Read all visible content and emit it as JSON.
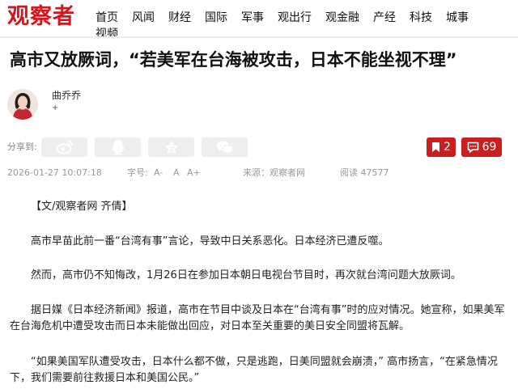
{
  "header": {
    "logo": "观察者",
    "nav": [
      "首页",
      "风闻",
      "财经",
      "国际",
      "军事",
      "观出行",
      "观金融",
      "产经",
      "科技",
      "城事",
      "视频"
    ]
  },
  "article": {
    "title": "高市又放厥词，“若美军在台海被攻击，日本不能坐视不理”",
    "author": {
      "name": "曲乔乔",
      "mark": "+"
    },
    "share": {
      "label": "分享到:"
    },
    "favorites": "2",
    "comments": "69",
    "meta": {
      "datetime": "2026-01-27 10:07:18",
      "font_label": "字号:",
      "font_minus": "A-",
      "font_normal": "A",
      "font_plus": "A+",
      "source": "来源：观察者网",
      "views": "阅读 47577"
    },
    "paragraphs": [
      "【文/观察者网 齐倩】",
      "高市早苗此前一番“台湾有事”言论，导致中日关系恶化。日本经济已遭反噬。",
      "然而，高市仍不知悔改，1月26日在参加日本朝日电视台节目时，再次就台湾问题大放厥词。",
      "据日媒《日本经济新闻》报道，高市在节目中谈及日本在“台湾有事”时的应对情况。她宣称，如果美军在台海危机中遭受攻击而日本未能做出回应，对日本至关重要的美日安全同盟将瓦解。",
      "“如果美国军队遭受攻击，日本什么都不做，只是逃跑，日美同盟就会崩溃，” 高市扬言，“在紧急情况下，我们需要前往救援日本和美国公民。”"
    ]
  },
  "colors": {
    "brand": "#d9141d",
    "button": "#ca1f1f"
  },
  "icons": [
    "weibo-icon",
    "qq-icon",
    "qzone-icon",
    "wechat-icon",
    "bookmark-icon",
    "comment-icon"
  ]
}
